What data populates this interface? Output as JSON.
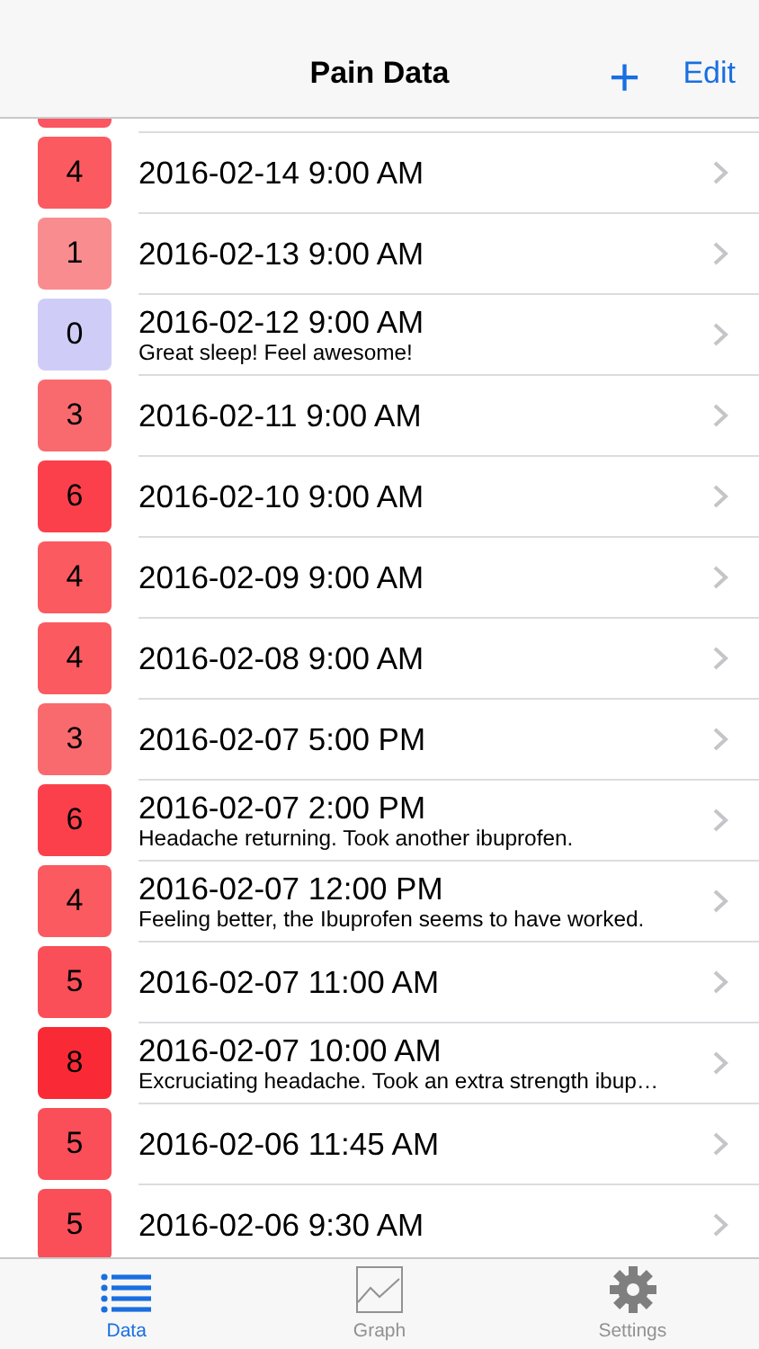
{
  "nav_bar": {
    "title": "Pain Data",
    "add_button": "+",
    "edit_button": "Edit"
  },
  "top_sliver": {
    "color": "#fa5560"
  },
  "entries": [
    {
      "level": "4",
      "date": "2016-02-14 9:00 AM",
      "color": "#fa5a60"
    },
    {
      "level": "1",
      "date": "2016-02-13 9:00 AM",
      "color": "#f98c8e"
    },
    {
      "level": "0",
      "date": "2016-02-12 9:00 AM",
      "note": "Great sleep! Feel awesome!",
      "color": "#cfcdf8"
    },
    {
      "level": "3",
      "date": "2016-02-11 9:00 AM",
      "color": "#f96a6e"
    },
    {
      "level": "6",
      "date": "2016-02-10 9:00 AM",
      "color": "#fb404c"
    },
    {
      "level": "4",
      "date": "2016-02-09 9:00 AM",
      "color": "#fa5a60"
    },
    {
      "level": "4",
      "date": "2016-02-08 9:00 AM",
      "color": "#fa5a60"
    },
    {
      "level": "3",
      "date": "2016-02-07 5:00 PM",
      "color": "#f96a6e"
    },
    {
      "level": "6",
      "date": "2016-02-07 2:00 PM",
      "note": "Headache returning. Took another ibuprofen.",
      "color": "#fb404c"
    },
    {
      "level": "4",
      "date": "2016-02-07 12:00 PM",
      "note": "Feeling better, the Ibuprofen seems to have worked.",
      "color": "#fa5a60"
    },
    {
      "level": "5",
      "date": "2016-02-07 11:00 AM",
      "color": "#fa4e58"
    },
    {
      "level": "8",
      "date": "2016-02-07 10:00 AM",
      "note": "Excruciating headache. Took an extra strength ibup…",
      "color": "#f92a36"
    },
    {
      "level": "5",
      "date": "2016-02-06 11:45 AM",
      "color": "#fa4e58"
    },
    {
      "level": "5",
      "date": "2016-02-06 9:30 AM",
      "color": "#fa4e58"
    }
  ],
  "tab_bar": [
    {
      "kind": "list",
      "label": "Data",
      "selected": true
    },
    {
      "kind": "graph",
      "label": "Graph",
      "selected": false
    },
    {
      "kind": "gear",
      "label": "Settings",
      "selected": false
    }
  ]
}
